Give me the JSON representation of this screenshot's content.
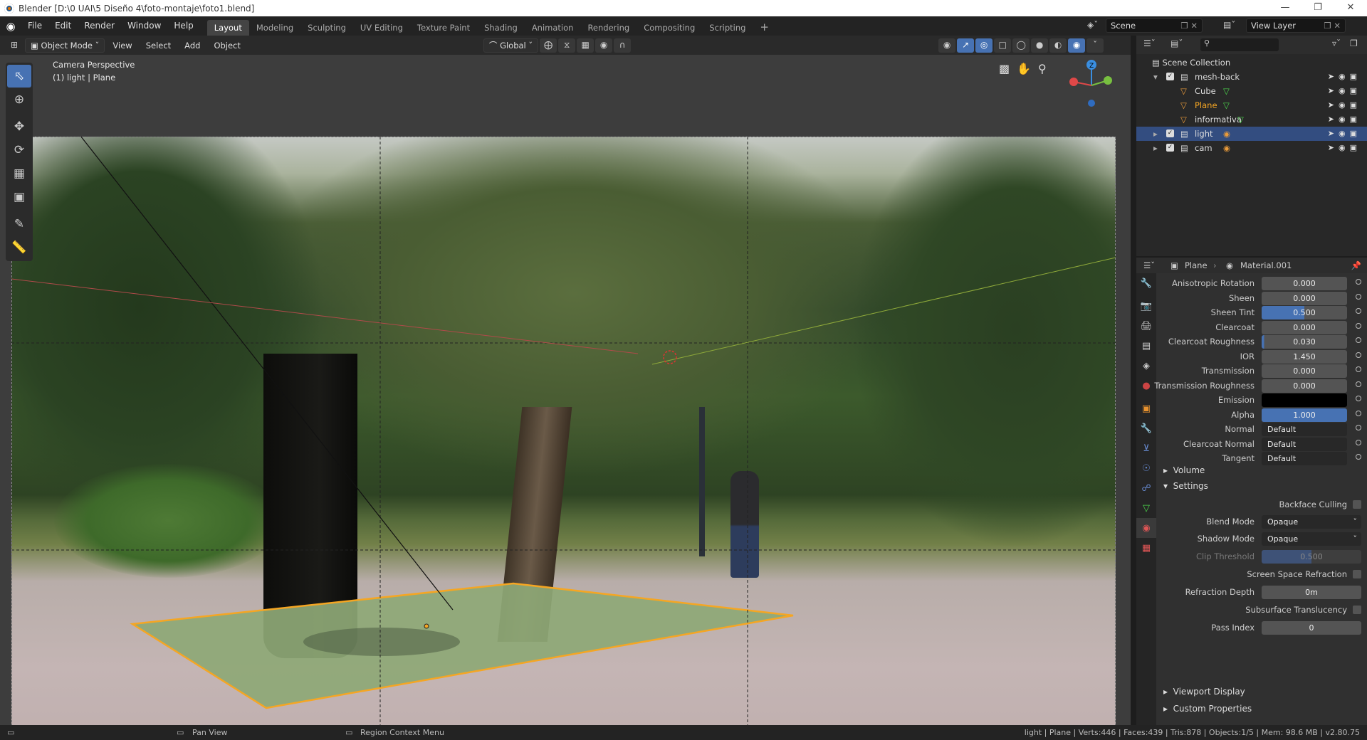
{
  "window": {
    "title": "Blender [D:\\0 UAI\\5 Diseño 4\\foto-montaje\\foto1.blend]"
  },
  "menu": {
    "file": "File",
    "edit": "Edit",
    "render": "Render",
    "window": "Window",
    "help": "Help"
  },
  "workspaces": [
    "Layout",
    "Modeling",
    "Sculpting",
    "UV Editing",
    "Texture Paint",
    "Shading",
    "Animation",
    "Rendering",
    "Compositing",
    "Scripting"
  ],
  "active_workspace": "Layout",
  "scene": {
    "name": "Scene",
    "view_layer": "View Layer"
  },
  "viewport_header": {
    "mode": "Object Mode",
    "view": "View",
    "select": "Select",
    "add": "Add",
    "object": "Object",
    "orientation": "Global"
  },
  "viewport": {
    "title": "Camera Perspective",
    "subtitle": "(1) light | Plane"
  },
  "outliner": {
    "root": "Scene Collection",
    "items": [
      {
        "name": "mesh-back",
        "kind": "collection",
        "level": 1,
        "selected": false
      },
      {
        "name": "Cube",
        "kind": "mesh",
        "level": 2,
        "selected": false
      },
      {
        "name": "Plane",
        "kind": "mesh",
        "level": 2,
        "selected": false,
        "highlight": true
      },
      {
        "name": "informativa",
        "kind": "mesh",
        "level": 2,
        "selected": false
      },
      {
        "name": "light",
        "kind": "collection",
        "level": 1,
        "selected": true
      },
      {
        "name": "cam",
        "kind": "collection",
        "level": 1,
        "selected": false
      }
    ]
  },
  "properties": {
    "breadcrumb_object": "Plane",
    "breadcrumb_material": "Material.001",
    "rows": [
      {
        "label": "Anisotropic Rotation",
        "value": "0.000",
        "type": "num"
      },
      {
        "label": "Sheen",
        "value": "0.000",
        "type": "num"
      },
      {
        "label": "Sheen Tint",
        "value": "0.500",
        "type": "slider",
        "fill": 0.5
      },
      {
        "label": "Clearcoat",
        "value": "0.000",
        "type": "num"
      },
      {
        "label": "Clearcoat Roughness",
        "value": "0.030",
        "type": "slider",
        "fill": 0.03
      },
      {
        "label": "IOR",
        "value": "1.450",
        "type": "num"
      },
      {
        "label": "Transmission",
        "value": "0.000",
        "type": "num"
      },
      {
        "label": "Transmission Roughness",
        "value": "0.000",
        "type": "num"
      },
      {
        "label": "Emission",
        "value": "",
        "type": "color",
        "color": "#000000"
      },
      {
        "label": "Alpha",
        "value": "1.000",
        "type": "slider",
        "fill": 1.0
      },
      {
        "label": "Normal",
        "value": "Default",
        "type": "enum"
      },
      {
        "label": "Clearcoat Normal",
        "value": "Default",
        "type": "enum"
      },
      {
        "label": "Tangent",
        "value": "Default",
        "type": "enum"
      }
    ],
    "sections": {
      "volume": "Volume",
      "settings": "Settings",
      "viewport_display": "Viewport Display",
      "custom_properties": "Custom Properties"
    },
    "settings": {
      "backface_culling": "Backface Culling",
      "blend_mode_label": "Blend Mode",
      "blend_mode": "Opaque",
      "shadow_mode_label": "Shadow Mode",
      "shadow_mode": "Opaque",
      "clip_threshold_label": "Clip Threshold",
      "clip_threshold": "0.500",
      "ssr": "Screen Space Refraction",
      "refraction_depth_label": "Refraction Depth",
      "refraction_depth": "0m",
      "sss": "Subsurface Translucency",
      "pass_index_label": "Pass Index",
      "pass_index": "0"
    }
  },
  "status": {
    "pan": "Pan View",
    "context": "Region Context Menu",
    "stats": "light | Plane | Verts:446 | Faces:439 | Tris:878 | Objects:1/5 | Mem: 98.6 MB | v2.80.75"
  },
  "colors": {
    "accent": "#4772b3",
    "selection": "#334d80",
    "orange": "#f5a623",
    "plane": "#8ea876"
  }
}
